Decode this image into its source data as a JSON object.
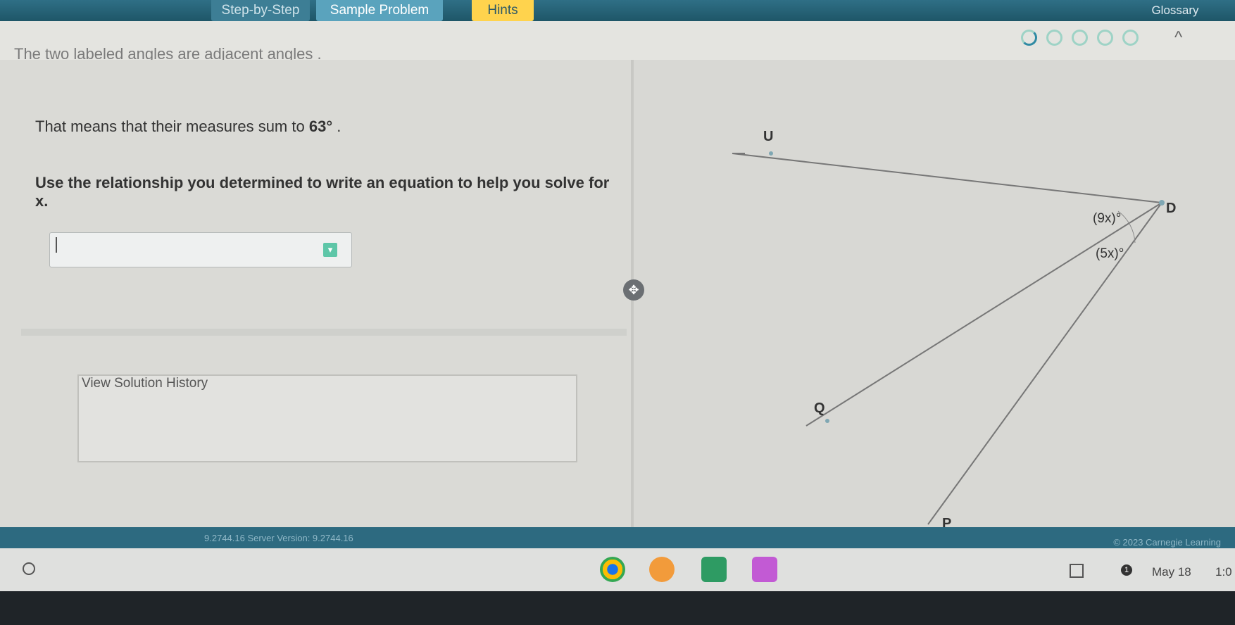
{
  "topbar": {
    "step_tab": "Step-by-Step",
    "sample_problem": "Sample Problem",
    "hints": "Hints",
    "glossary": "Glossary"
  },
  "problem": {
    "previous_text": "The two labeled angles are adjacent angles .",
    "sum_prefix": "That means that their measures sum to",
    "sum_value": "63°",
    "sum_suffix": ".",
    "instruction": "Use the relationship you determined to write an equation to help you solve for x.",
    "answer_value": "",
    "view_history": "View Solution History"
  },
  "progress": {
    "total_steps": 5,
    "completed_steps": 0
  },
  "diagram": {
    "point_u": "U",
    "point_d": "D",
    "point_q": "Q",
    "point_p": "P",
    "angle_top": "(9x)°",
    "angle_bottom": "(5x)°"
  },
  "status": {
    "version": "9.2744.16  Server Version: 9.2744.16",
    "copyright": "© 2023 Carnegie Learning"
  },
  "shelf": {
    "date": "May 18",
    "time": "1:0",
    "notification_count": "1"
  },
  "colors": {
    "topbar": "#1e5668",
    "hints_button": "#ffd34d",
    "progress_ring": "#9ed3c6"
  }
}
